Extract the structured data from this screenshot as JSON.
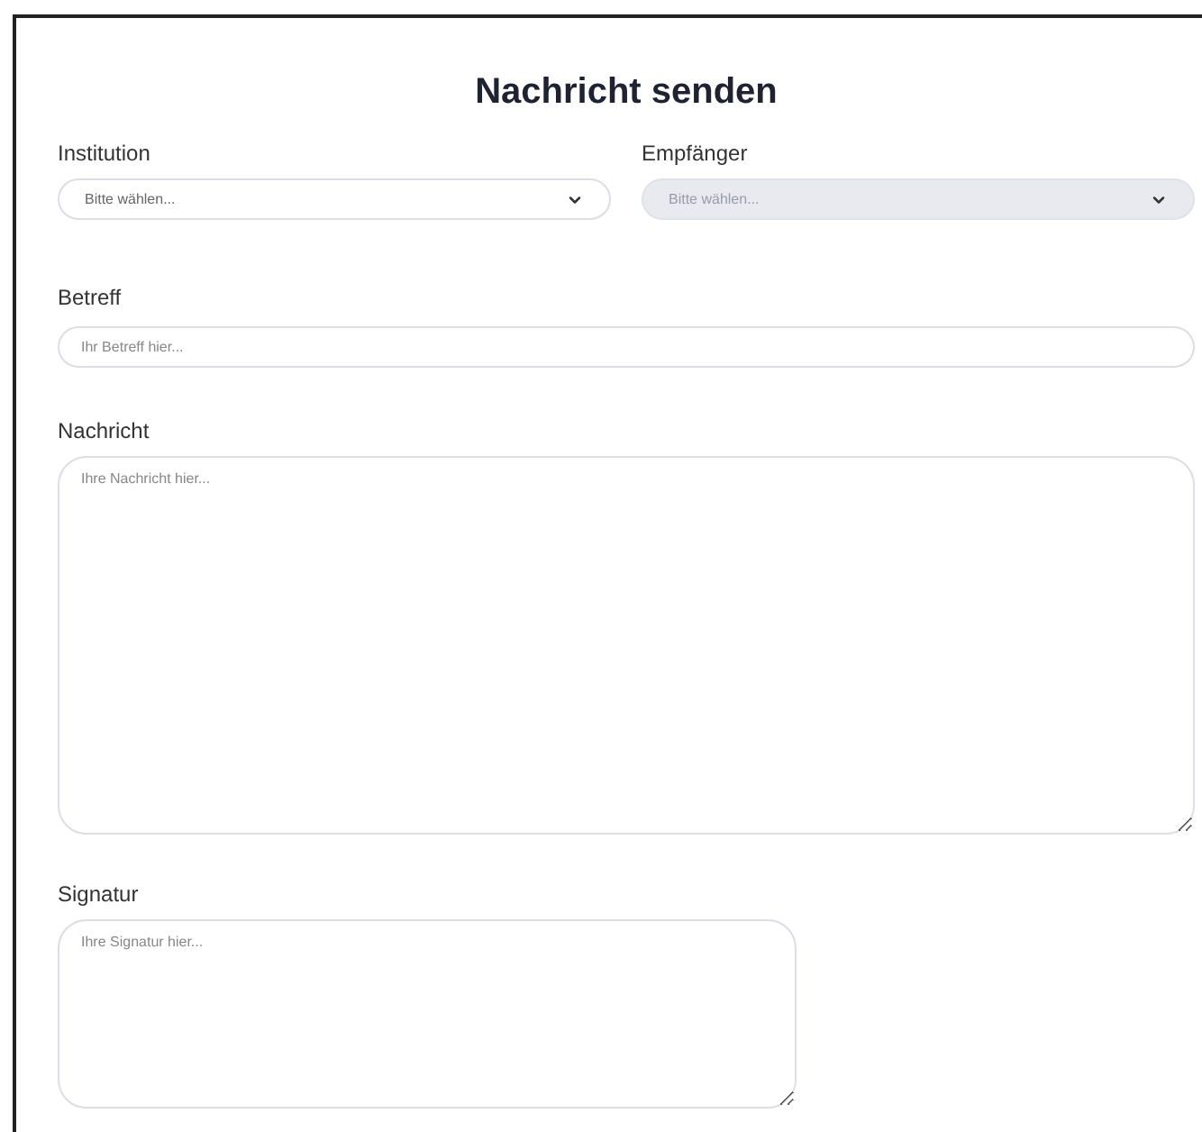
{
  "title": "Nachricht senden",
  "selects": [
    {
      "label": "Institution",
      "placeholder": "Bitte wählen...",
      "disabled": false
    },
    {
      "label": "Empfänger",
      "placeholder": "Bitte wählen...",
      "disabled": true
    }
  ],
  "subject": {
    "label": "Betreff",
    "placeholder": "Ihr Betreff hier..."
  },
  "message": {
    "label": "Nachricht",
    "placeholder": "Ihre Nachricht hier..."
  },
  "signature": {
    "label": "Signatur",
    "placeholder": "Ihre Signatur hier..."
  }
}
